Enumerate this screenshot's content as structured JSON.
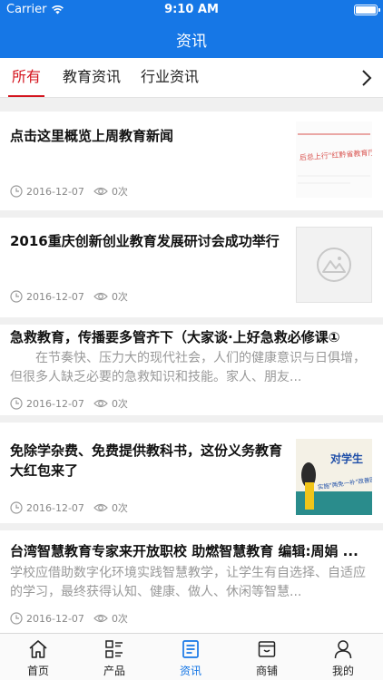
{
  "status_bar": {
    "carrier": "Carrier",
    "time": "9:10 AM"
  },
  "nav": {
    "title": "资讯"
  },
  "tabs": [
    {
      "label": "所有"
    },
    {
      "label": "教育资讯"
    },
    {
      "label": "行业资讯"
    }
  ],
  "articles": [
    {
      "title": "点击这里概览上周教育新闻",
      "date": "2016-12-07",
      "views": "0次",
      "thumb": "red-text-banner"
    },
    {
      "title": "2016重庆创新创业教育发展研讨会成功举行",
      "date": "2016-12-07",
      "views": "0次",
      "thumb": "placeholder-image"
    },
    {
      "title": "急救教育，传播要多管齐下（大家谈·上好急救必修课①",
      "summary": "在节奏快、压力大的现代社会，人们的健康意识与日俱增，但很多人缺乏必要的急救知识和技能。家人、朋友...",
      "date": "2016-12-07",
      "views": "0次"
    },
    {
      "title": "免除学杂费、免费提供教科书，这份义务教育大红包来了",
      "date": "2016-12-07",
      "views": "0次",
      "thumb": "poster-image",
      "thumb_text": "对学生",
      "thumb_caption": "实施\"两免一补\"改善困难"
    },
    {
      "title": "台湾智慧教育专家来开放职校 助燃智慧教育 编辑:周娟 ...",
      "summary": "学校应借助数字化环境实践智慧教学，让学生有自选择、自适应的学习，最终获得认知、健康、做人、休闲等智慧...",
      "date": "2016-12-07",
      "views": "0次"
    }
  ],
  "thumb1_text": "后总上行\"红黔省教育厅\"决定",
  "tabbar": [
    {
      "label": "首页",
      "icon": "home-icon"
    },
    {
      "label": "产品",
      "icon": "grid-list-icon"
    },
    {
      "label": "资讯",
      "icon": "news-icon"
    },
    {
      "label": "商铺",
      "icon": "shop-icon"
    },
    {
      "label": "我的",
      "icon": "user-icon"
    }
  ],
  "colors": {
    "primary": "#1677e6",
    "active_tab": "#d4141e"
  }
}
